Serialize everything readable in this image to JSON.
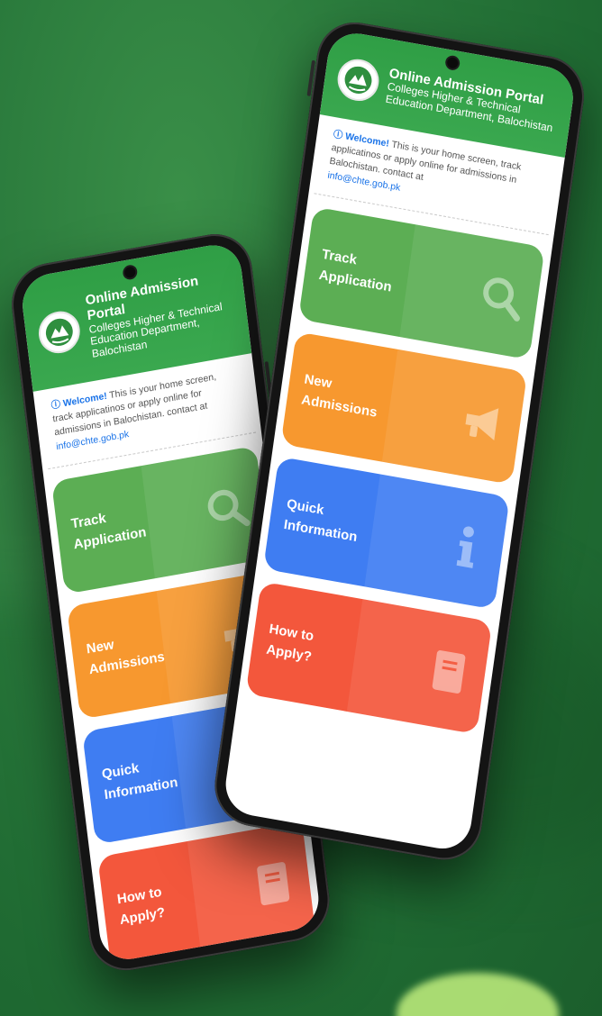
{
  "portal": {
    "title": "Online Admission Portal",
    "subtitle_line1": "Colleges Higher & Technical",
    "subtitle_line2": "Education Department, Balochistan"
  },
  "welcome": {
    "strong": "Welcome!",
    "text": " This is your home screen, track applicatinos or apply online for admissions in Balochistan. contact at",
    "email": "info@chte.gob.pk"
  },
  "cards": [
    {
      "line1": "Track",
      "line2": "Application",
      "icon": "search-icon",
      "color": "#5cae54"
    },
    {
      "line1": "New",
      "line2": "Admissions",
      "icon": "megaphone-icon",
      "color": "#f7982f"
    },
    {
      "line1": "Quick",
      "line2": "Information",
      "icon": "info-icon",
      "color": "#3f7df2"
    },
    {
      "line1": "How to",
      "line2": "Apply?",
      "icon": "book-icon",
      "color": "#f3573c"
    }
  ],
  "colors": {
    "header_green": "#2f9e45",
    "link_blue": "#1a73e8"
  }
}
